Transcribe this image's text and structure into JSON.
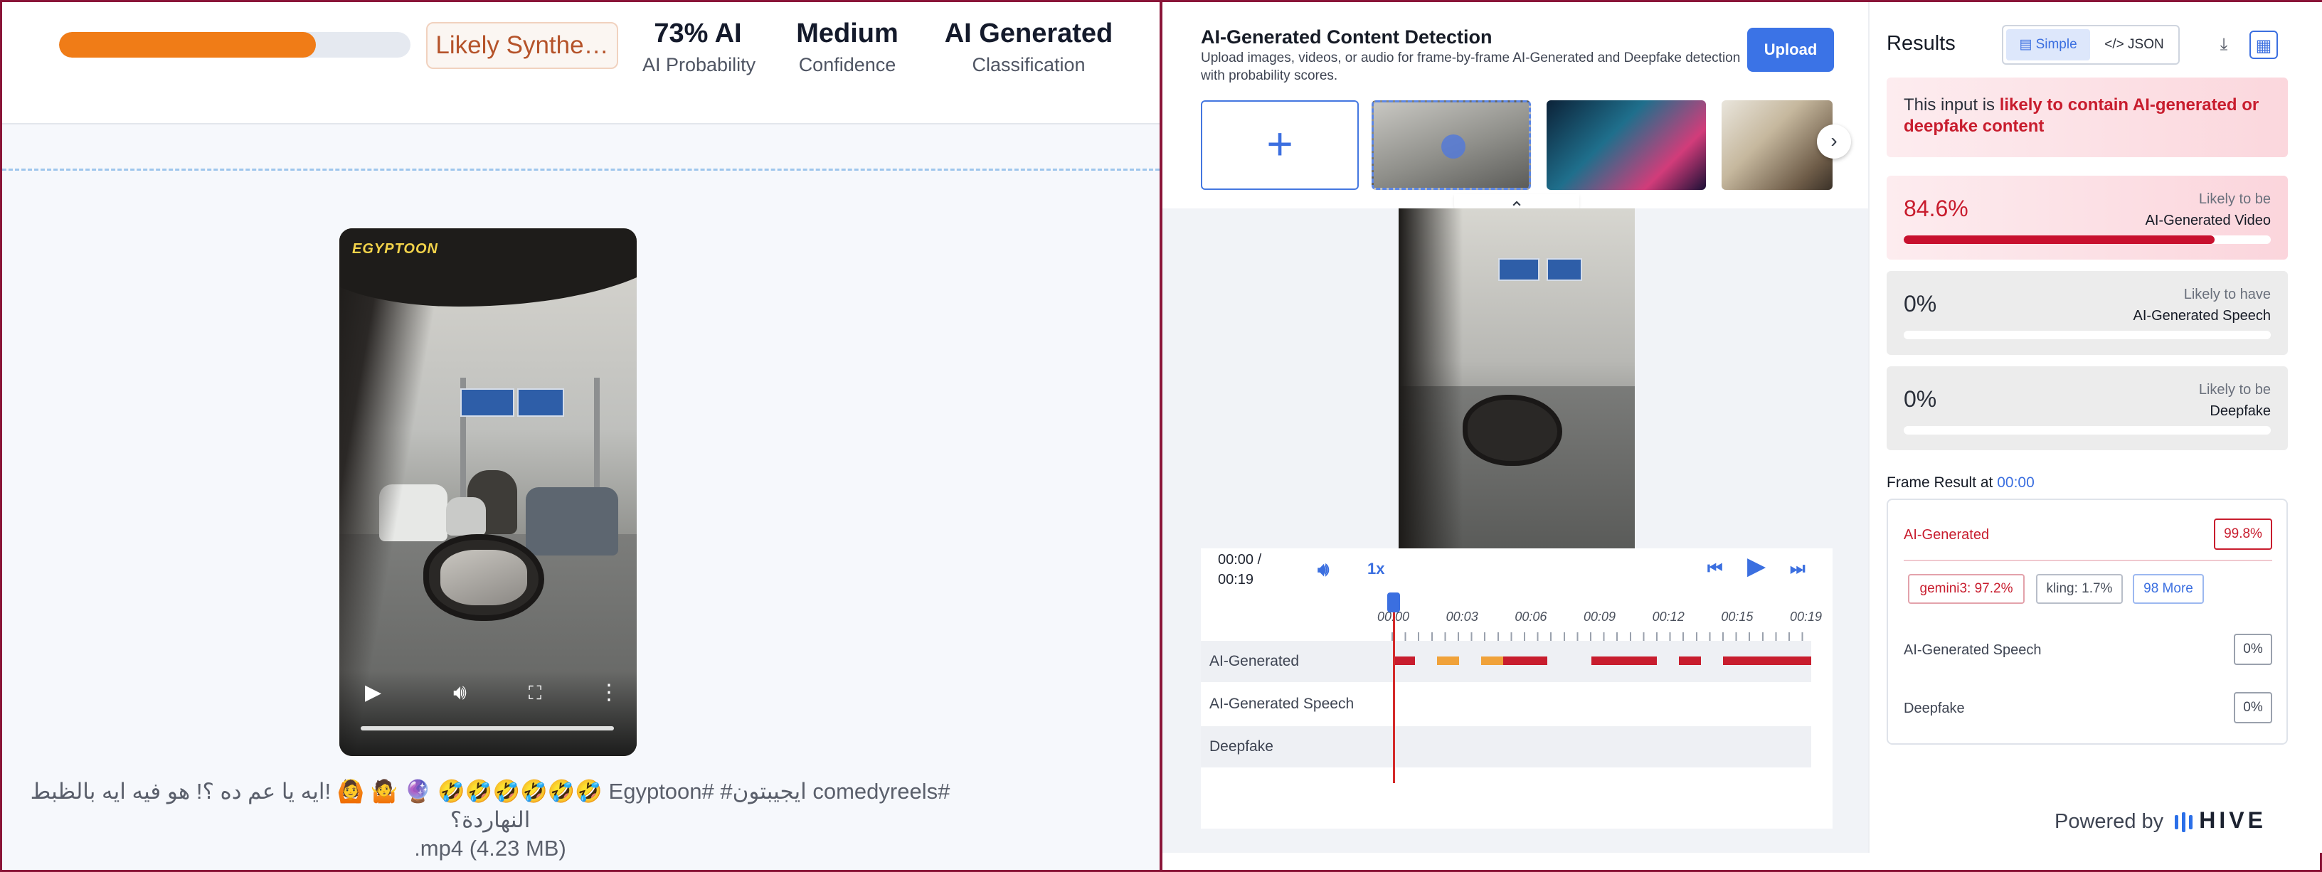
{
  "summary": {
    "ai_probability_fraction": 0.73,
    "verdict": "Likely Synthe…",
    "stats": [
      {
        "value": "73% AI",
        "label": "AI Probability"
      },
      {
        "value": "Medium",
        "label": "Confidence"
      },
      {
        "value": "AI Generated",
        "label": "Classification"
      }
    ]
  },
  "video": {
    "watermark": "EGYPTOON",
    "caption_line1": "#comedyreels ايجيبتون# #Egyptoon 🤣🤣🤣🤣🤣🤣 🔮 🤷 🙆 !ايه يا عم ده ؟! هو فيه ايه بالظبط النهاردة؟",
    "caption_line2": ".mp4 (4.23 MB)"
  },
  "detector": {
    "title": "AI-Generated Content Detection",
    "description": "Upload images, videos, or audio for frame-by-frame AI-Generated and Deepfake detection with probability scores.",
    "upload_label": "Upload",
    "add_symbol": "+",
    "next_symbol": "›",
    "collapse_symbol": "⌃"
  },
  "player": {
    "current_time": "00:00 /",
    "duration": "00:19",
    "speed": "1x",
    "ticks": [
      "00:00",
      "00:03",
      "00:06",
      "00:09",
      "00:12",
      "00:15",
      "00:19"
    ],
    "rows": [
      {
        "label": "AI-Generated"
      },
      {
        "label": "AI-Generated Speech"
      },
      {
        "label": "Deepfake"
      }
    ],
    "segments_seconds": [
      {
        "start": 0.0,
        "end": 1.0,
        "level": "high"
      },
      {
        "start": 2.0,
        "end": 3.0,
        "level": "medium"
      },
      {
        "start": 4.0,
        "end": 5.0,
        "level": "medium"
      },
      {
        "start": 5.0,
        "end": 7.0,
        "level": "high"
      },
      {
        "start": 9.0,
        "end": 12.0,
        "level": "high"
      },
      {
        "start": 13.0,
        "end": 14.0,
        "level": "high"
      },
      {
        "start": 15.0,
        "end": 19.0,
        "level": "high"
      }
    ],
    "duration_seconds": 19,
    "colors": {
      "high": "#c81d2e",
      "medium": "#f0a23a"
    }
  },
  "results": {
    "title": "Results",
    "toggle_simple": "Simple",
    "toggle_json": "</> JSON",
    "alert_prefix": "This input is ",
    "alert_strong": "likely to contain AI-generated or deepfake content",
    "cards": [
      {
        "pct": "84.6%",
        "fraction": 0.846,
        "line1": "Likely to be",
        "line2": "AI-Generated Video"
      },
      {
        "pct": "0%",
        "fraction": 0,
        "line1": "Likely to have",
        "line2": "AI-Generated Speech"
      },
      {
        "pct": "0%",
        "fraction": 0,
        "line1": "Likely to be",
        "line2": "Deepfake"
      }
    ],
    "frame_title": "Frame Result at ",
    "frame_time": "00:00",
    "frame_rows": [
      {
        "label": "AI-Generated",
        "value": "99.8%"
      },
      {
        "label": "AI-Generated Speech",
        "value": "0%"
      },
      {
        "label": "Deepfake",
        "value": "0%"
      }
    ],
    "chips": [
      "gemini3: 97.2%",
      "kling: 1.7%",
      "98 More"
    ],
    "powered_by": "Powered by",
    "brand": "HIVE"
  },
  "colors": {
    "accent": "#3b73e6",
    "danger": "#c81d2e",
    "orange": "#f07c17"
  }
}
